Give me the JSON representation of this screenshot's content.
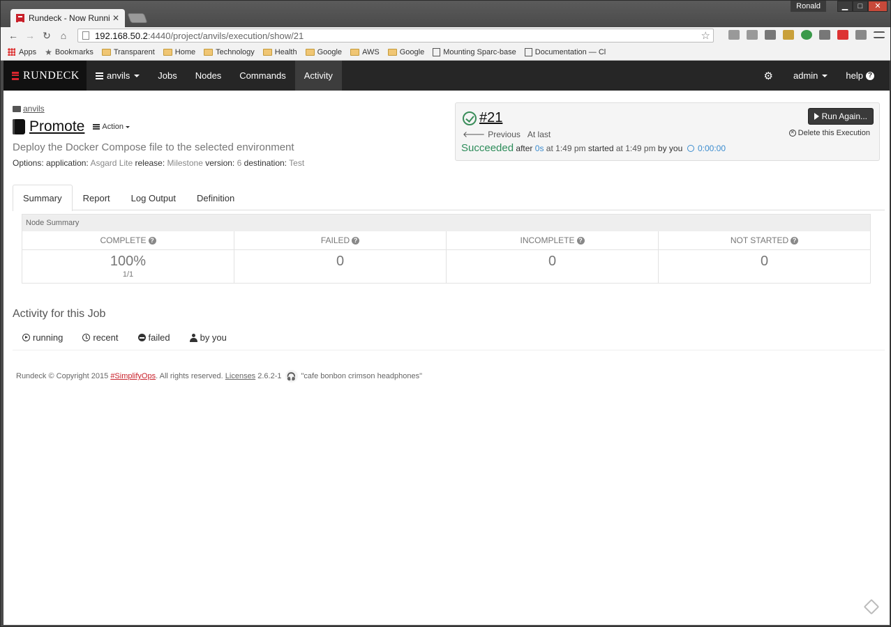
{
  "browser": {
    "tab_title": "Rundeck - Now Running -",
    "tab_close": "✕",
    "user": "Ronald",
    "url_host": "192.168.50.2",
    "url_path": ":4440/project/anvils/execution/show/21",
    "bookmarks": [
      "Apps",
      "Bookmarks",
      "Transparent",
      "Home",
      "Technology",
      "Health",
      "Google",
      "AWS",
      "Google",
      "Mounting Sparc-base",
      "Documentation — Cl"
    ]
  },
  "nav": {
    "brand": "RUNDECK",
    "project": "anvils",
    "items": [
      "Jobs",
      "Nodes",
      "Commands",
      "Activity"
    ],
    "user": "admin",
    "help": "help"
  },
  "job": {
    "breadcrumb": "anvils",
    "name": "Promote",
    "action_label": "Action",
    "description": "Deploy the Docker Compose file to the selected environment",
    "options_label": "Options:",
    "options": [
      {
        "key": "application:",
        "value": "Asgard Lite"
      },
      {
        "key": "release:",
        "value": "Milestone"
      },
      {
        "key": "version:",
        "value": "6"
      },
      {
        "key": "destination:",
        "value": "Test"
      }
    ]
  },
  "execution": {
    "id": "#21",
    "previous": "Previous",
    "at_last": "At last",
    "status": "Succeeded",
    "after": "after",
    "duration": "0s",
    "at_time": "at 1:49 pm",
    "started": "started",
    "started_time": "at 1:49 pm",
    "by_you": "by you",
    "elapsed": "0:00:00",
    "run_again": "Run Again...",
    "delete": "Delete this Execution"
  },
  "tabs": [
    "Summary",
    "Report",
    "Log Output",
    "Definition"
  ],
  "node_summary": {
    "title": "Node Summary",
    "columns": [
      {
        "label": "COMPLETE",
        "value": "100%",
        "sub": "1/1"
      },
      {
        "label": "FAILED",
        "value": "0",
        "sub": ""
      },
      {
        "label": "INCOMPLETE",
        "value": "0",
        "sub": ""
      },
      {
        "label": "NOT STARTED",
        "value": "0",
        "sub": ""
      }
    ]
  },
  "activity": {
    "title": "Activity for this Job",
    "filters": [
      "running",
      "recent",
      "failed",
      "by you"
    ]
  },
  "footer": {
    "copyright": "Rundeck © Copyright 2015",
    "hashtag": "#SimplifyOps",
    "rights": ". All rights reserved.",
    "licenses": "Licenses",
    "version": "2.6.2-1",
    "codename": "\"cafe bonbon crimson headphones\""
  }
}
